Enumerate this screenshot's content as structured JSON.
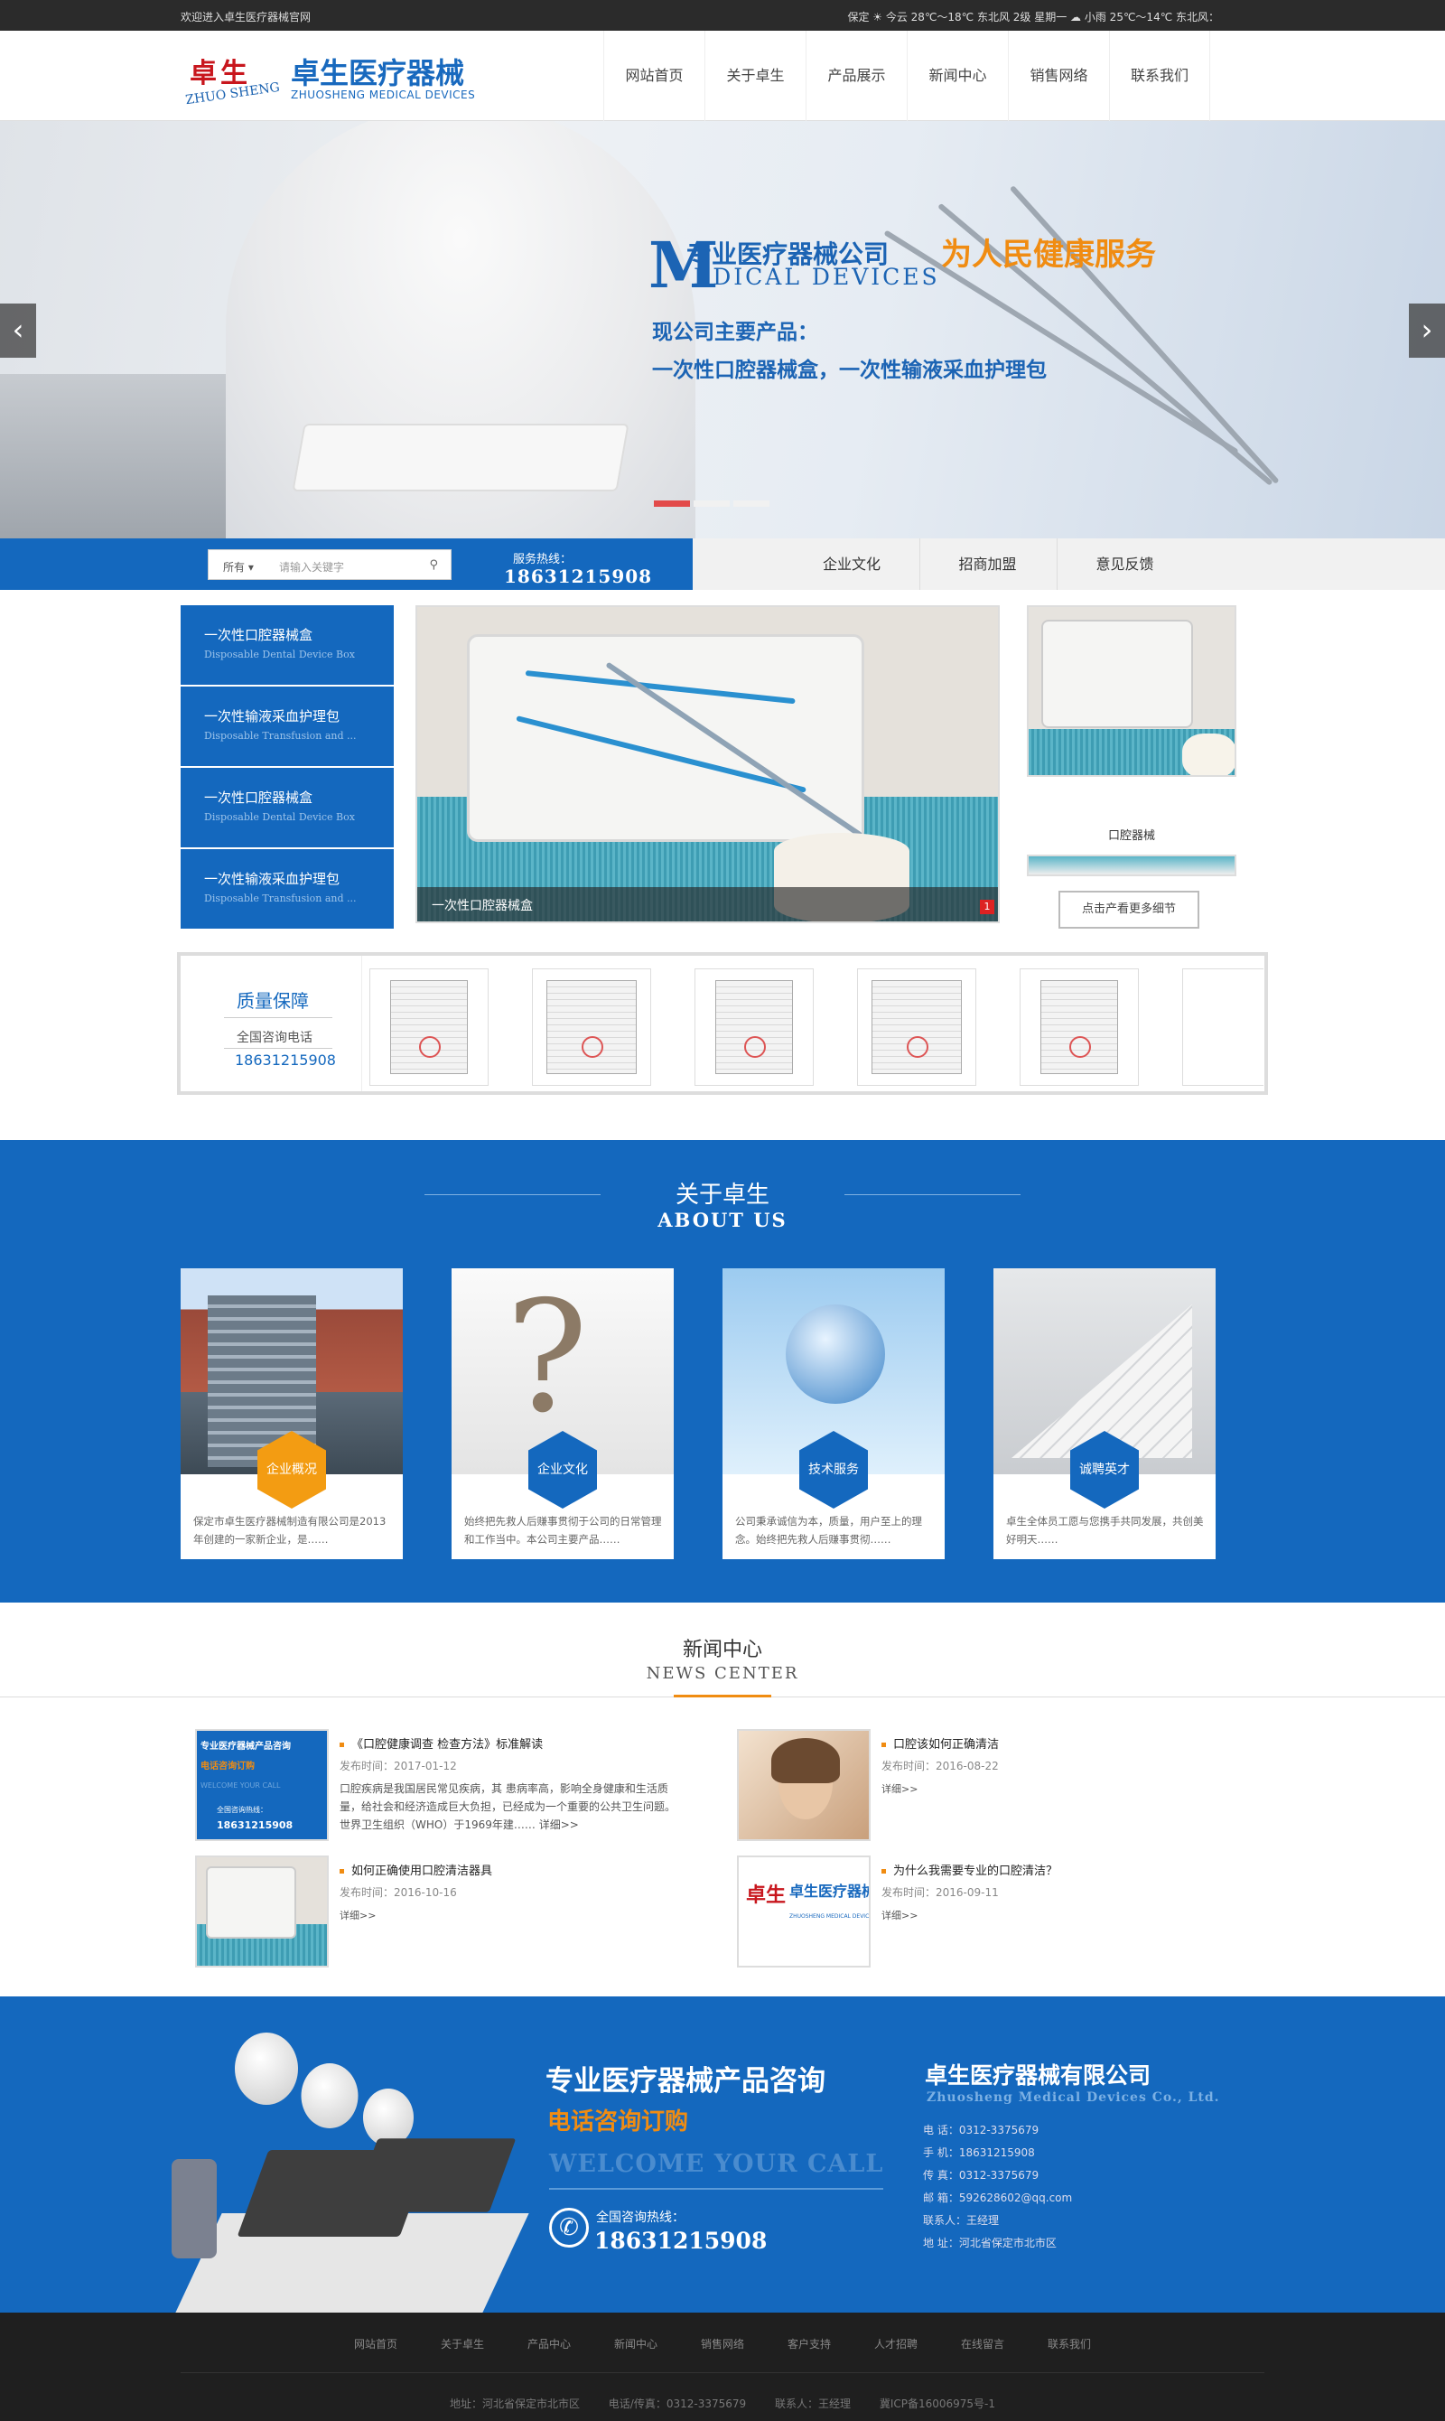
{
  "topbar": {
    "welcome": "欢迎进入卓生医疗器械官网",
    "weather": "保定 ☀ 今云 28℃～18℃ 东北风 2级 星期一 ☁ 小雨 25℃～14℃ 东北风："
  },
  "logo": {
    "cn_mark": "卓生",
    "en_mark": "ZHUO SHENG",
    "title": "卓生医疗器械",
    "subtitle": "ZHUOSHENG MEDICAL DEVICES"
  },
  "nav": [
    "网站首页",
    "关于卓生",
    "产品展示",
    "新闻中心",
    "销售网络",
    "联系我们"
  ],
  "banner": {
    "big_letter": "M",
    "line1": "专业医疗器械公司",
    "line1_orange": "为人民健康服务",
    "en": "EDICAL DEVICES",
    "main_products_label": "现公司主要产品：",
    "main_products": "一次性口腔器械盒，一次性输液采血护理包",
    "prev_arrow": "‹",
    "next_arrow": "›",
    "slides": 3,
    "active_slide": 1
  },
  "search": {
    "select_value": "所有",
    "placeholder": "请输入关键字",
    "hotline_label": "服务热线：",
    "hotline": "18631215908",
    "links": [
      "企业文化",
      "招商加盟",
      "意见反馈"
    ]
  },
  "products": {
    "categories": [
      {
        "cn": "一次性口腔器械盒",
        "en": "Disposable Dental Device Box"
      },
      {
        "cn": "一次性输液采血护理包",
        "en": "Disposable Transfusion and ..."
      },
      {
        "cn": "一次性口腔器械盒",
        "en": "Disposable Dental Device Box"
      },
      {
        "cn": "一次性输液采血护理包",
        "en": "Disposable Transfusion and ..."
      }
    ],
    "main_caption": "一次性口腔器械盒",
    "main_index": "1",
    "thumb_caption": "口腔器械",
    "more_button": "点击产看更多细节"
  },
  "quality": {
    "title": "质量保障",
    "tel_label": "全国咨询电话",
    "tel": "18631215908",
    "cert_count": 6
  },
  "about": {
    "title": "关于卓生",
    "subtitle": "ABOUT US",
    "cards": [
      {
        "label": "企业概况",
        "desc": "保定市卓生医疗器械制造有限公司是2013年创建的一家新企业，是……",
        "color": "#f39c12"
      },
      {
        "label": "企业文化",
        "desc": "始终把先救人后赚事贯彻于公司的日常管理和工作当中。本公司主要产品……",
        "color": "#1468be"
      },
      {
        "label": "技术服务",
        "desc": "公司秉承诚信为本，质量，用户至上的理念。始终把先救人后赚事贯彻……",
        "color": "#1468be"
      },
      {
        "label": "诚聘英才",
        "desc": "卓生全体员工愿与您携手共同发展，共创美好明天……",
        "color": "#1468be"
      }
    ]
  },
  "news": {
    "title": "新闻中心",
    "subtitle": "NEWS CENTER",
    "date_label": "发布时间：",
    "more": "详细>>",
    "items": [
      {
        "title": "《口腔健康调查 检查方法》标准解读",
        "date": "2017-01-12",
        "summary": "口腔疾病是我国居民常见疾病，其 患病率高，影响全身健康和生活质量，给社会和经济造成巨大负担，已经成为一个重要的公共卫生问题。世界卫生组织（WHO）于1969年建……",
        "more": "详细>>"
      },
      {
        "title": "口腔该如何正确清洁",
        "date": "2016-08-22",
        "summary": "",
        "more": "详细>>"
      },
      {
        "title": "如何正确使用口腔清洁器具",
        "date": "2016-10-16",
        "summary": "",
        "more": "详细>>"
      },
      {
        "title": "为什么我需要专业的口腔清洁？",
        "date": "2016-09-11",
        "summary": "",
        "more": "详细>>"
      }
    ],
    "ad_thumb": {
      "line1": "专业医疗器械产品咨询",
      "line2": "电话咨询订购",
      "line3": "WELCOME YOUR CALL",
      "line4": "全国咨询热线：",
      "line5": "18631215908"
    }
  },
  "contact": {
    "title": "专业医疗器械产品咨询",
    "orange": "电话咨询订购",
    "welcome": "WELCOME YOUR CALL",
    "hotline_label": "全国咨询热线：",
    "hotline": "18631215908",
    "company": "卓生医疗器械有限公司",
    "company_en": "Zhuosheng Medical Devices Co., Ltd.",
    "info": [
      "电  话：0312-3375679",
      "手  机：18631215908",
      "传  真：0312-3375679",
      "邮  箱：592628602@qq.com",
      "联系人：王经理",
      "地  址：河北省保定市北市区"
    ]
  },
  "footer": {
    "nav": [
      "网站首页",
      "关于卓生",
      "产品中心",
      "新闻中心",
      "销售网络",
      "客户支持",
      "人才招聘",
      "在线留言",
      "联系我们"
    ],
    "address": "地址：河北省保定市北市区",
    "phone": "电话/传真：0312-3375679",
    "contact": "联系人：王经理",
    "icp": "冀ICP备16006975号-1"
  }
}
